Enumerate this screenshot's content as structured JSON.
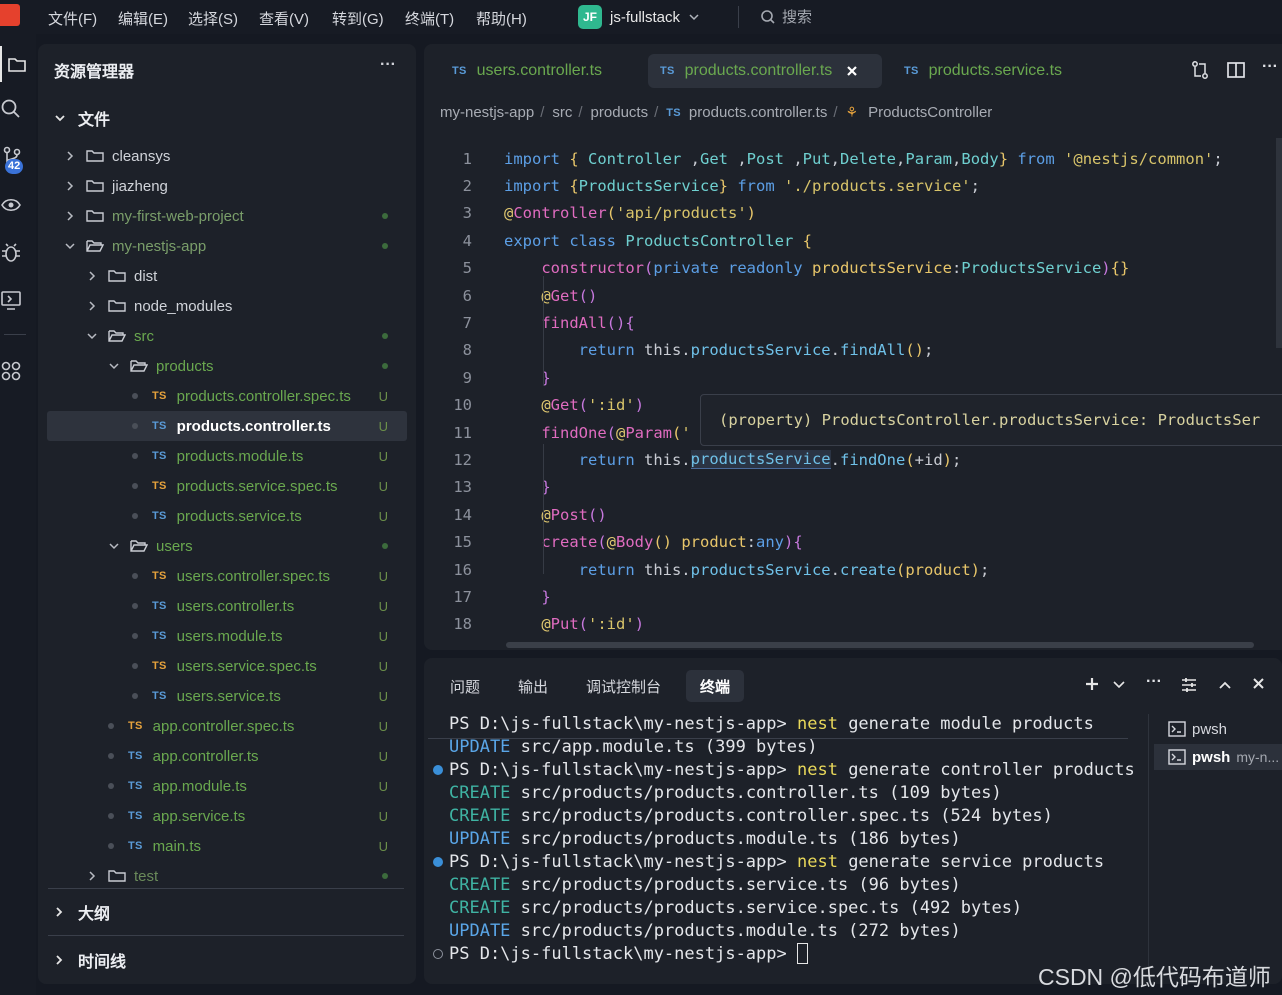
{
  "menu": [
    "文件(F)",
    "编辑(E)",
    "选择(S)",
    "查看(V)",
    "转到(G)",
    "终端(T)",
    "帮助(H)"
  ],
  "project": {
    "badge": "JF",
    "name": "js-fullstack"
  },
  "search": {
    "label": "搜索"
  },
  "activity": {
    "scm_badge": "42"
  },
  "explorer": {
    "title": "资源管理器",
    "more": "···",
    "section": "文件",
    "outline": "大纲",
    "timeline": "时间线",
    "rows": [
      {
        "label": "cleansys",
        "kind": "folder",
        "depth": 0,
        "status": ""
      },
      {
        "label": "jiazheng",
        "kind": "folder",
        "depth": 0,
        "status": ""
      },
      {
        "label": "my-first-web-project",
        "kind": "folder",
        "depth": 0,
        "status": "dot"
      },
      {
        "label": "my-nestjs-app",
        "kind": "folder-open",
        "depth": 0,
        "status": "dot"
      },
      {
        "label": "dist",
        "kind": "folder",
        "depth": 1,
        "status": ""
      },
      {
        "label": "node_modules",
        "kind": "folder",
        "depth": 1,
        "status": ""
      },
      {
        "label": "src",
        "kind": "folder-open",
        "depth": 1,
        "status": "dot"
      },
      {
        "label": "products",
        "kind": "folder-open",
        "depth": 2,
        "status": "dot"
      },
      {
        "label": "products.controller.spec.ts",
        "kind": "spec",
        "depth": 3,
        "status": "U"
      },
      {
        "label": "products.controller.ts",
        "kind": "ts",
        "depth": 3,
        "status": "U",
        "selected": true
      },
      {
        "label": "products.module.ts",
        "kind": "ts",
        "depth": 3,
        "status": "U"
      },
      {
        "label": "products.service.spec.ts",
        "kind": "spec",
        "depth": 3,
        "status": "U"
      },
      {
        "label": "products.service.ts",
        "kind": "ts",
        "depth": 3,
        "status": "U"
      },
      {
        "label": "users",
        "kind": "folder-open",
        "depth": 2,
        "status": "dot"
      },
      {
        "label": "users.controller.spec.ts",
        "kind": "spec",
        "depth": 3,
        "status": "U"
      },
      {
        "label": "users.controller.ts",
        "kind": "ts",
        "depth": 3,
        "status": "U"
      },
      {
        "label": "users.module.ts",
        "kind": "ts",
        "depth": 3,
        "status": "U"
      },
      {
        "label": "users.service.spec.ts",
        "kind": "spec",
        "depth": 3,
        "status": "U"
      },
      {
        "label": "users.service.ts",
        "kind": "ts",
        "depth": 3,
        "status": "U"
      },
      {
        "label": "app.controller.spec.ts",
        "kind": "spec",
        "depth": 2,
        "status": "U"
      },
      {
        "label": "app.controller.ts",
        "kind": "ts",
        "depth": 2,
        "status": "U"
      },
      {
        "label": "app.module.ts",
        "kind": "ts",
        "depth": 2,
        "status": "U"
      },
      {
        "label": "app.service.ts",
        "kind": "ts",
        "depth": 2,
        "status": "U"
      },
      {
        "label": "main.ts",
        "kind": "ts",
        "depth": 2,
        "status": "U"
      },
      {
        "label": "test",
        "kind": "folder",
        "depth": 1,
        "status": "dot"
      }
    ]
  },
  "editor": {
    "ts_badge": "TS",
    "tabs": [
      {
        "label": "users.controller.ts",
        "active": false
      },
      {
        "label": "products.controller.ts",
        "active": true
      },
      {
        "label": "products.service.ts",
        "active": false
      }
    ],
    "breadcrumb": [
      "my-nestjs-app",
      "src",
      "products",
      "products.controller.ts",
      "ProductsController"
    ],
    "hover": "(property) ProductsController.productsService: ProductsSer",
    "lines": [
      {
        "n": "1",
        "parts": [
          [
            "kw",
            "import "
          ],
          [
            "par",
            "{ "
          ],
          [
            "cls",
            "Controller"
          ],
          [
            "pl",
            " ,"
          ],
          [
            "cls",
            "Get"
          ],
          [
            "pl",
            " ,"
          ],
          [
            "cls",
            "Post"
          ],
          [
            "pl",
            " ,"
          ],
          [
            "cls",
            "Put"
          ],
          [
            "pl",
            ","
          ],
          [
            "cls",
            "Delete"
          ],
          [
            "pl",
            ","
          ],
          [
            "cls",
            "Param"
          ],
          [
            "pl",
            ","
          ],
          [
            "cls",
            "Body"
          ],
          [
            "par",
            "} "
          ],
          [
            "kw",
            "from "
          ],
          [
            "str",
            "'@nestjs/common'"
          ],
          [
            "pl",
            ";"
          ]
        ]
      },
      {
        "n": "2",
        "parts": [
          [
            "kw",
            "import "
          ],
          [
            "par",
            "{"
          ],
          [
            "cls",
            "ProductsService"
          ],
          [
            "par",
            "} "
          ],
          [
            "kw",
            "from "
          ],
          [
            "str",
            "'./products.service'"
          ],
          [
            "pl",
            ";"
          ]
        ]
      },
      {
        "n": "3",
        "parts": [
          [
            "dec",
            "@"
          ],
          [
            "fn",
            "Controller"
          ],
          [
            "par",
            "("
          ],
          [
            "str",
            "'api/products'"
          ],
          [
            "par",
            ")"
          ]
        ]
      },
      {
        "n": "4",
        "parts": [
          [
            "kw",
            "export class "
          ],
          [
            "cls",
            "ProductsController "
          ],
          [
            "par",
            "{"
          ]
        ]
      },
      {
        "n": "5",
        "parts": [
          [
            "pl",
            "    "
          ],
          [
            "fn",
            "constructor"
          ],
          [
            "brk",
            "("
          ],
          [
            "kw",
            "private readonly "
          ],
          [
            "par",
            "productsService"
          ],
          [
            "pl",
            ":"
          ],
          [
            "cls",
            "ProductsService"
          ],
          [
            "brk",
            ")"
          ],
          [
            "par",
            "{}"
          ]
        ]
      },
      {
        "n": "6",
        "parts": [
          [
            "pl",
            "    "
          ],
          [
            "dec",
            "@"
          ],
          [
            "fn",
            "Get"
          ],
          [
            "brk",
            "()"
          ]
        ]
      },
      {
        "n": "7",
        "parts": [
          [
            "pl",
            "    "
          ],
          [
            "fn",
            "findAll"
          ],
          [
            "brk",
            "(){"
          ]
        ]
      },
      {
        "n": "8",
        "parts": [
          [
            "pl",
            "        "
          ],
          [
            "kw",
            "return "
          ],
          [
            "pl",
            "this."
          ],
          [
            "prop",
            "productsService"
          ],
          [
            "pl",
            "."
          ],
          [
            "prop",
            "findAll"
          ],
          [
            "par",
            "()"
          ],
          [
            "pl",
            ";"
          ]
        ]
      },
      {
        "n": "9",
        "parts": [
          [
            "pl",
            "    "
          ],
          [
            "brk",
            "}"
          ]
        ]
      },
      {
        "n": "10",
        "parts": [
          [
            "pl",
            "    "
          ],
          [
            "dec",
            "@"
          ],
          [
            "fn",
            "Get"
          ],
          [
            "brk",
            "("
          ],
          [
            "str",
            "':id'"
          ],
          [
            "brk",
            ")"
          ]
        ]
      },
      {
        "n": "11",
        "parts": [
          [
            "pl",
            "    "
          ],
          [
            "fn",
            "findOne"
          ],
          [
            "brk",
            "("
          ],
          [
            "dec",
            "@"
          ],
          [
            "fn",
            "Param"
          ],
          [
            "par",
            "("
          ],
          [
            "str",
            "'"
          ]
        ]
      },
      {
        "n": "12",
        "parts": [
          [
            "pl",
            "        "
          ],
          [
            "kw",
            "return "
          ],
          [
            "pl",
            "this."
          ],
          [
            "prop",
            "productsService"
          ],
          [
            "pl",
            "."
          ],
          [
            "prop",
            "findOne"
          ],
          [
            "par",
            "("
          ],
          [
            "pl",
            "+id"
          ],
          [
            "par",
            ")"
          ],
          [
            "pl",
            ";"
          ]
        ]
      },
      {
        "n": "13",
        "parts": [
          [
            "pl",
            "    "
          ],
          [
            "brk",
            "}"
          ]
        ]
      },
      {
        "n": "14",
        "parts": [
          [
            "pl",
            "    "
          ],
          [
            "dec",
            "@"
          ],
          [
            "fn",
            "Post"
          ],
          [
            "brk",
            "()"
          ]
        ]
      },
      {
        "n": "15",
        "parts": [
          [
            "pl",
            "    "
          ],
          [
            "fn",
            "create"
          ],
          [
            "brk",
            "("
          ],
          [
            "dec",
            "@"
          ],
          [
            "fn",
            "Body"
          ],
          [
            "par",
            "() "
          ],
          [
            "par",
            "product"
          ],
          [
            "pl",
            ":"
          ],
          [
            "kw",
            "any"
          ],
          [
            "brk",
            "){"
          ]
        ]
      },
      {
        "n": "16",
        "parts": [
          [
            "pl",
            "        "
          ],
          [
            "kw",
            "return "
          ],
          [
            "pl",
            "this."
          ],
          [
            "prop",
            "productsService"
          ],
          [
            "pl",
            "."
          ],
          [
            "prop",
            "create"
          ],
          [
            "par",
            "("
          ],
          [
            "par",
            "product"
          ],
          [
            "par",
            ")"
          ],
          [
            "pl",
            ";"
          ]
        ]
      },
      {
        "n": "17",
        "parts": [
          [
            "pl",
            "    "
          ],
          [
            "brk",
            "}"
          ]
        ]
      },
      {
        "n": "18",
        "parts": [
          [
            "pl",
            "    "
          ],
          [
            "dec",
            "@"
          ],
          [
            "fn",
            "Put"
          ],
          [
            "brk",
            "("
          ],
          [
            "str",
            "':id'"
          ],
          [
            "brk",
            ")"
          ]
        ]
      }
    ]
  },
  "panel": {
    "tabs": [
      "问题",
      "输出",
      "调试控制台",
      "终端"
    ],
    "active_tab": "终端",
    "instances": [
      {
        "label": "pwsh",
        "sub": ""
      },
      {
        "label": "pwsh",
        "sub": "my-n..."
      }
    ],
    "lines": [
      {
        "mark": "",
        "parts": [
          [
            "p",
            "PS D:\\js-fullstack\\my-nestjs-app> "
          ],
          [
            "y",
            "nest"
          ],
          [
            "p",
            " generate module products"
          ]
        ]
      },
      {
        "mark": "",
        "parts": [
          [
            "u",
            "UPDATE"
          ],
          [
            "p",
            " src/app.module.ts (399 bytes)"
          ]
        ]
      },
      {
        "mark": "dot",
        "parts": [
          [
            "p",
            "PS D:\\js-fullstack\\my-nestjs-app> "
          ],
          [
            "y",
            "nest"
          ],
          [
            "p",
            " generate controller products"
          ]
        ]
      },
      {
        "mark": "",
        "parts": [
          [
            "c",
            "CREATE"
          ],
          [
            "p",
            " src/products/products.controller.ts (109 bytes)"
          ]
        ]
      },
      {
        "mark": "",
        "parts": [
          [
            "c",
            "CREATE"
          ],
          [
            "p",
            " src/products/products.controller.spec.ts (524 bytes)"
          ]
        ]
      },
      {
        "mark": "",
        "parts": [
          [
            "u",
            "UPDATE"
          ],
          [
            "p",
            " src/products/products.module.ts (186 bytes)"
          ]
        ]
      },
      {
        "mark": "dot",
        "parts": [
          [
            "p",
            "PS D:\\js-fullstack\\my-nestjs-app> "
          ],
          [
            "y",
            "nest"
          ],
          [
            "p",
            " generate service products"
          ]
        ]
      },
      {
        "mark": "",
        "parts": [
          [
            "c",
            "CREATE"
          ],
          [
            "p",
            " src/products/products.service.ts (96 bytes)"
          ]
        ]
      },
      {
        "mark": "",
        "parts": [
          [
            "c",
            "CREATE"
          ],
          [
            "p",
            " src/products/products.service.spec.ts (492 bytes)"
          ]
        ]
      },
      {
        "mark": "",
        "parts": [
          [
            "u",
            "UPDATE"
          ],
          [
            "p",
            " src/products/products.module.ts (272 bytes)"
          ]
        ]
      },
      {
        "mark": "ring",
        "parts": [
          [
            "p",
            "PS D:\\js-fullstack\\my-nestjs-app> "
          ]
        ]
      }
    ]
  },
  "watermark": "CSDN @低代码布道师"
}
